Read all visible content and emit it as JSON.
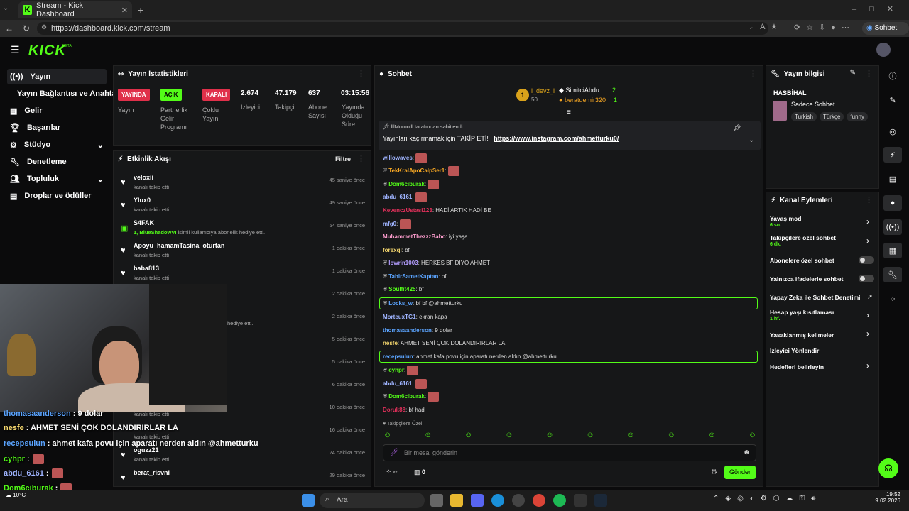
{
  "browser": {
    "tab_title": "Stream - Kick Dashboard",
    "url": "https://dashboard.kick.com/stream",
    "profile_label": "Sohbet et"
  },
  "header": {
    "logo": "KICK",
    "logo_badge": "BETA"
  },
  "sidebar": {
    "items": [
      {
        "label": "Yayın"
      },
      {
        "label": "Yayın Bağlantısı ve Anahtarı"
      },
      {
        "label": "Gelir"
      },
      {
        "label": "Başarılar"
      },
      {
        "label": "Stüdyo"
      },
      {
        "label": "Denetleme"
      },
      {
        "label": "Topluluk"
      },
      {
        "label": "Droplar ve ödüller"
      }
    ]
  },
  "stats": {
    "title": "Yayın İstatistikleri",
    "live": {
      "badge": "YAYINDA",
      "label": "Yayın"
    },
    "partner": {
      "badge": "AÇIK",
      "label": "Partnerlik Gelir Programı"
    },
    "multi": {
      "badge": "KAPALI",
      "label": "Çoklu Yayın"
    },
    "viewers": {
      "value": "2.674",
      "label": "İzleyici"
    },
    "followers": {
      "value": "47.179",
      "label": "Takipçi"
    },
    "subs": {
      "value": "637",
      "label": "Abone Sayısı"
    },
    "uptime": {
      "value": "03:15:56",
      "label": "Yayında Olduğu Süre"
    }
  },
  "activity": {
    "title": "Etkinlik Akışı",
    "filter": "Filtre",
    "items": [
      {
        "name": "veloxii",
        "sub": "kanalı takip etti",
        "time": "45 saniye önce"
      },
      {
        "name": "Ylux0",
        "sub": "kanalı takip etti",
        "time": "49 saniye önce"
      },
      {
        "name": "S4FAK",
        "sub_user": "1, BlueShadowVI",
        "sub": "isimli kullanıcıya abonelik hediye etti.",
        "time": "54 saniye önce"
      },
      {
        "name": "Apoyu_hamamTasina_oturtan",
        "sub": "kanalı takip etti",
        "time": "1 dakika önce"
      },
      {
        "name": "baba813",
        "sub": "kanalı takip etti",
        "time": "1 dakika önce"
      },
      {
        "time": "2 dakika önce"
      },
      {
        "sub": "hediye etti.",
        "time": "2 dakika önce"
      },
      {
        "time": "5 dakika önce"
      },
      {
        "time": "5 dakika önce"
      },
      {
        "time": "6 dakika önce"
      },
      {
        "sub": "kanalı takip etti",
        "time": "10 dakika önce"
      },
      {
        "sub": "kanalı takip etti",
        "time": "16 dakika önce"
      },
      {
        "name": "oguzz21",
        "sub": "kanalı takip etti",
        "time": "24 dakika önce"
      },
      {
        "name": "berat_risvnl",
        "time": "29 dakika önce"
      }
    ]
  },
  "chat": {
    "title": "Sohbet",
    "leaders": {
      "first": {
        "name": "l_devz_l",
        "count": "50"
      },
      "second": {
        "name": "SimitciAbdu",
        "count": "2"
      },
      "third": {
        "name": "beratdemir320",
        "count": "1"
      }
    },
    "pinned": {
      "by": "lllMuroolll tarafından sabitlendi",
      "text": "Yayınları kaçırmamak için TAKİP ETİ! |",
      "link": "https://www.instagram.com/ahmetturku0/"
    },
    "messages": [
      {
        "user": "willowaves",
        "text": "",
        "color": "#9fb4ff"
      },
      {
        "user": "TekKralApoCalpSer1",
        "text": "",
        "color": "#f5a623"
      },
      {
        "user": "Dom6ciburak",
        "text": "",
        "color": "#53fc18"
      },
      {
        "user": "abdu_6161",
        "text": "",
        "color": "#9fb4ff"
      },
      {
        "user": "KevenczUstasi123",
        "text": "HADİ ARTIK HADİ BE",
        "color": "#e0305a"
      },
      {
        "user": "mfg0",
        "text": "",
        "color": "#9fb4ff"
      },
      {
        "user": "MuhammetThezzzBabo",
        "text": "iyi yaşa",
        "color": "#ff9ecf"
      },
      {
        "user": "forexql",
        "text": "bf",
        "color": "#f5d76e"
      },
      {
        "user": "lowrin1003",
        "text": "HERKES BF DİYO AHMET",
        "color": "#b39dff"
      },
      {
        "user": "TahirSametKaptan",
        "text": "bf",
        "color": "#5ba4ff"
      },
      {
        "user": "Soulfit425",
        "text": "bf",
        "color": "#53fc18"
      },
      {
        "user": "Locks_w",
        "text": "bf bf @ahmetturku",
        "color": "#5ba4ff"
      },
      {
        "user": "MorteuxTG1",
        "text": "ekran kapa",
        "color": "#9fb4ff"
      },
      {
        "user": "thomasaanderson",
        "text": "9 dolar",
        "color": "#5ba4ff"
      },
      {
        "user": "nesfe",
        "text": "AHMET SENİ ÇOK DOLANDIRIRLAR LA",
        "color": "#f5d76e"
      },
      {
        "user": "recepsulun",
        "text": "ahmet kafa povu için aparatı nerden aldın @ahmetturku",
        "color": "#5ba4ff"
      },
      {
        "user": "cyhpr",
        "text": "",
        "color": "#53fc18"
      },
      {
        "user": "abdu_6161",
        "text": "",
        "color": "#9fb4ff"
      },
      {
        "user": "Dom6ciburak",
        "text": "",
        "color": "#53fc18"
      },
      {
        "user": "Doruk88",
        "text": "bf hadi",
        "color": "#e0305a"
      }
    ],
    "mode_label": "Takipçilere Özel",
    "input_placeholder": "Bir mesaj gönderin",
    "send_label": "Gönder",
    "viewers_icon_value": "0"
  },
  "stream_info": {
    "title": "Yayın bilgisi",
    "stream_title": "HASBİHAL",
    "category": "Sadece Sohbet",
    "tags": [
      "Turkish",
      "Türkçe",
      "funny"
    ]
  },
  "channel_actions": {
    "title": "Kanal Eylemleri",
    "slow_mode": {
      "label": "Yavaş mod",
      "value": "6 sn."
    },
    "followers_only": {
      "label": "Takipçilere özel sohbet",
      "value": "6 dk."
    },
    "subs_only": {
      "label": "Abonelere özel sohbet"
    },
    "emotes_only": {
      "label": "Yalnızca ifadelerle sohbet"
    },
    "ai_mod": {
      "label": "Yapay Zeka ile Sohbet Denetimi"
    },
    "account_age": {
      "label": "Hesap yaşı kısıtlaması",
      "value": "1 hf."
    },
    "banned_words": {
      "label": "Yasaklanmış kelimeler"
    },
    "raid": {
      "label": "İzleyici Yönlendir"
    },
    "goals": {
      "label": "Hedefleri belirleyin"
    }
  },
  "overlay": {
    "lines": [
      {
        "user": "thomasaanderson",
        "text": " : 9 dolar",
        "color": "#5ba4ff"
      },
      {
        "user": "nesfe",
        "text": " : AHMET SENİ ÇOK DOLANDIRIRLAR LA",
        "color": "#f5d76e"
      },
      {
        "user": "recepsulun",
        "text": " : ahmet kafa povu için aparatı nerden aldın @ahmetturku",
        "color": "#5ba4ff"
      },
      {
        "user": "cyhpr",
        "text": " :",
        "color": "#53fc18"
      },
      {
        "user": "abdu_6161",
        "text": " :",
        "color": "#9fb4ff"
      },
      {
        "user": "Dom6ciburak",
        "text": " :",
        "color": "#53fc18"
      },
      {
        "user": "Doruk88",
        "text": " : bf hadi",
        "color": "#e0305a"
      }
    ]
  },
  "taskbar": {
    "search": "Ara",
    "weather": "10°C",
    "time": "19:52",
    "date": "9.02.2026"
  }
}
